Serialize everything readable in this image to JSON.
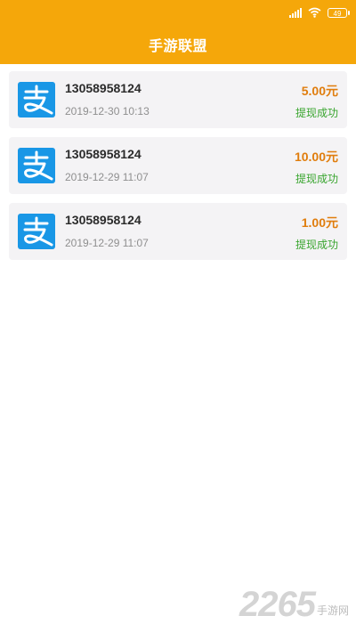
{
  "status_bar": {
    "battery": "49",
    "icons": [
      "signal-icon",
      "wifi-icon",
      "battery-icon"
    ]
  },
  "header": {
    "title": "手游联盟"
  },
  "records": [
    {
      "account": "13058958124",
      "time": "2019-12-30 10:13",
      "amount": "5.00元",
      "status": "提现成功"
    },
    {
      "account": "13058958124",
      "time": "2019-12-29 11:07",
      "amount": "10.00元",
      "status": "提现成功"
    },
    {
      "account": "13058958124",
      "time": "2019-12-29 11:07",
      "amount": "1.00元",
      "status": "提现成功"
    }
  ],
  "colors": {
    "header": "#f5a70a",
    "amount": "#e07d0d",
    "status": "#39a52f",
    "alipay": "#1997e6"
  },
  "watermark": {
    "number": "2265",
    "text": "手游网"
  }
}
